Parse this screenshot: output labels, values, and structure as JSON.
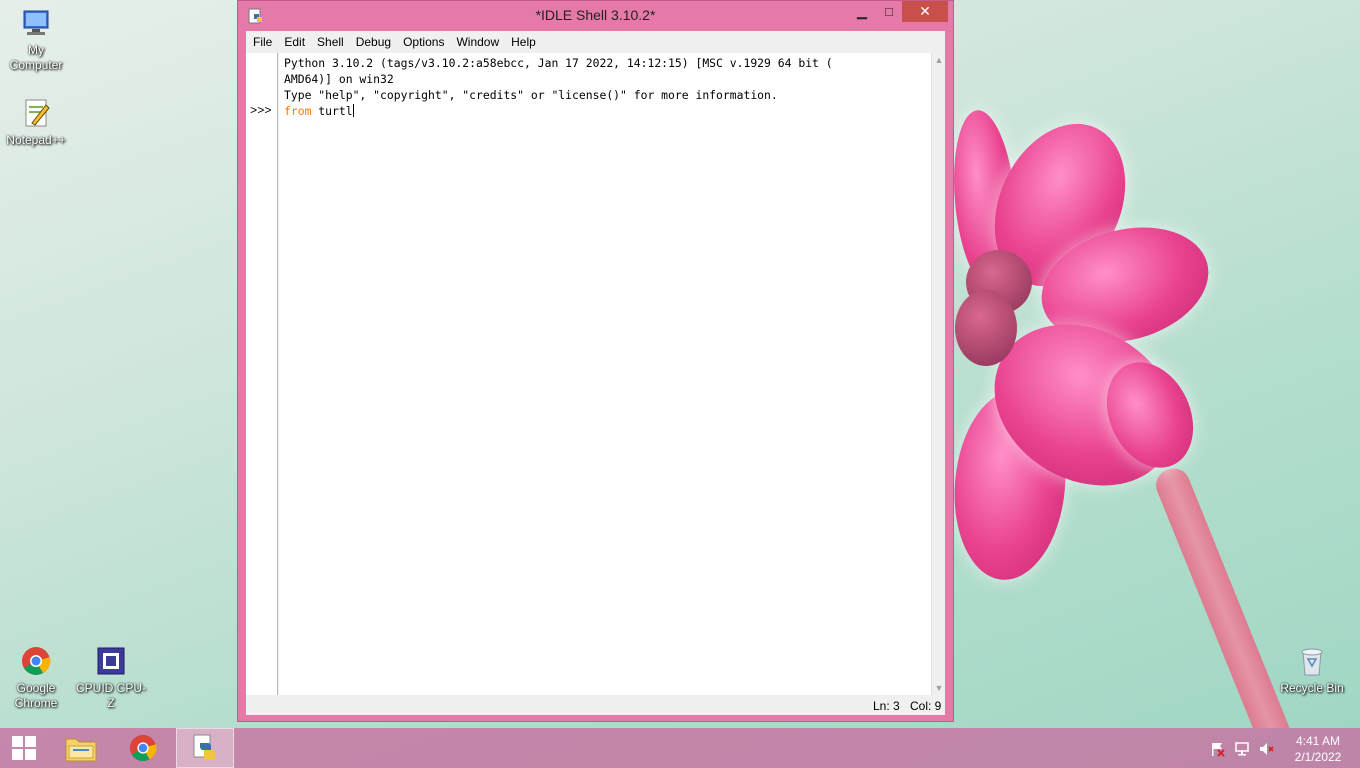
{
  "desktop": {
    "icons": [
      {
        "label": "My Computer"
      },
      {
        "label": "Notepad++"
      },
      {
        "label": "Google Chrome"
      },
      {
        "label": "CPUID CPU-Z"
      },
      {
        "label": "Recycle Bin"
      }
    ]
  },
  "window": {
    "title": "*IDLE Shell 3.10.2*",
    "min_glyph": "▁",
    "max_glyph": "□",
    "close_glyph": "✕",
    "menu": [
      "File",
      "Edit",
      "Shell",
      "Debug",
      "Options",
      "Window",
      "Help"
    ],
    "shell": {
      "banner_line1": "Python 3.10.2 (tags/v3.10.2:a58ebcc, Jan 17 2022, 14:12:15) [MSC v.1929 64 bit (",
      "banner_line2": "AMD64)] on win32",
      "banner_line3": "Type \"help\", \"copyright\", \"credits\" or \"license()\" for more information.",
      "prompt": ">>>",
      "input_keyword": "from",
      "input_text": " turtl"
    },
    "status": {
      "ln": "Ln: 3",
      "col": "Col: 9"
    }
  },
  "taskbar": {
    "items": [
      "start",
      "file-explorer",
      "google-chrome",
      "python-idle"
    ],
    "clock": {
      "time": "4:41 AM",
      "date": "2/1/2022"
    }
  },
  "colors": {
    "window_frame": "#e57aa9",
    "close_button": "#c7504a",
    "keyword": "#ff7700",
    "taskbar": "#c86ea0"
  }
}
